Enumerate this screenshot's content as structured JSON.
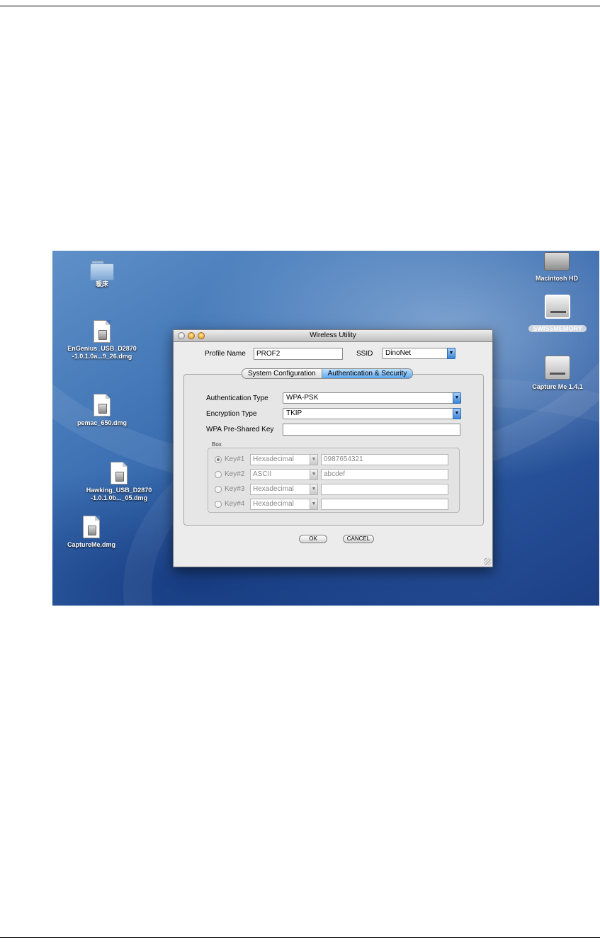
{
  "desktop": {
    "left_icons": [
      {
        "label": "暖床"
      },
      {
        "label_lines": [
          "EnGenius_USB_D2870",
          "-1.0.1.0a...9_26.dmg"
        ]
      },
      {
        "label": "pemac_650.dmg"
      },
      {
        "label_lines": [
          "Hawking_USB_D2870",
          "-1.0.1.0b..._05.dmg"
        ]
      },
      {
        "label": "CaptureMe.dmg"
      }
    ],
    "right_icons": [
      {
        "label": "Macintosh HD"
      },
      {
        "label": "SWISSMEMORY"
      },
      {
        "label": "Capture Me 1.4.1"
      }
    ]
  },
  "dialog": {
    "title": "Wireless Utility",
    "profile_name_label": "Profile Name",
    "profile_name_value": "PROF2",
    "ssid_label": "SSID",
    "ssid_value": "DinoNet",
    "tabs": [
      {
        "label": "System Configuration",
        "active": false
      },
      {
        "label": "Authentication & Security",
        "active": true
      }
    ],
    "auth_type_label": "Authentication Type",
    "auth_type_value": "WPA-PSK",
    "enc_type_label": "Encryption Type",
    "enc_type_value": "TKIP",
    "wpa_key_label": "WPA Pre-Shared Key",
    "wpa_key_value": "",
    "box_label": "Box",
    "keys": [
      {
        "label": "Key#1",
        "type": "Hexadecimal",
        "value": "0987654321",
        "selected": true
      },
      {
        "label": "Key#2",
        "type": "ASCII",
        "value": "abcdef",
        "selected": false
      },
      {
        "label": "Key#3",
        "type": "Hexadecimal",
        "value": "",
        "selected": false
      },
      {
        "label": "Key#4",
        "type": "Hexadecimal",
        "value": "",
        "selected": false
      }
    ],
    "ok_label": "OK",
    "cancel_label": "CANCEL"
  },
  "colors": {
    "accent_blue": "#3a86d8",
    "desktop_blue": "#3e72b4"
  }
}
